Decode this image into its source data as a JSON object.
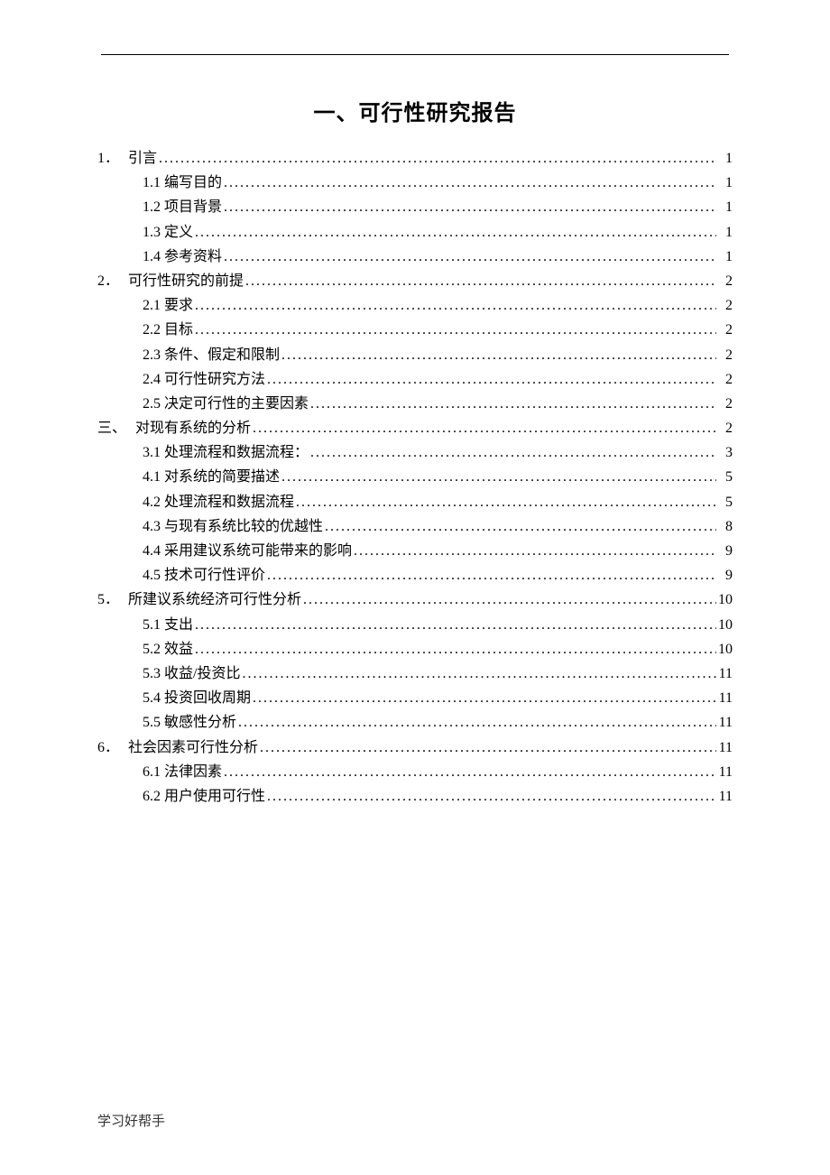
{
  "title": "一、可行性研究报告",
  "footer": "学习好帮手",
  "toc": [
    {
      "level": 1,
      "num": "1．",
      "label": "引言",
      "page": "1"
    },
    {
      "level": 2,
      "num": "1.1",
      "label": "编写目的",
      "page": "1"
    },
    {
      "level": 2,
      "num": "1.2",
      "label": "项目背景",
      "page": "1"
    },
    {
      "level": 2,
      "num": "1.3",
      "label": "定义",
      "page": "1"
    },
    {
      "level": 2,
      "num": "1.4",
      "label": "参考资料",
      "page": "1"
    },
    {
      "level": 1,
      "num": "2．",
      "label": "可行性研究的前提",
      "page": "2"
    },
    {
      "level": 2,
      "num": "2.1",
      "label": "要求",
      "page": "2"
    },
    {
      "level": 2,
      "num": "2.2",
      "label": "目标",
      "page": "2"
    },
    {
      "level": 2,
      "num": "2.3",
      "label": "条件、假定和限制",
      "page": "2"
    },
    {
      "level": 2,
      "num": "2.4",
      "label": "可行性研究方法",
      "page": "2"
    },
    {
      "level": 2,
      "num": "2.5",
      "label": "决定可行性的主要因素",
      "page": "2"
    },
    {
      "level": 1,
      "num": "三、",
      "label": "对现有系统的分析",
      "page": "2"
    },
    {
      "level": 2,
      "num": "3.1",
      "label": "处理流程和数据流程：",
      "page": "3"
    },
    {
      "level": 2,
      "num": "4.1",
      "label": "对系统的简要描述",
      "page": "5"
    },
    {
      "level": 2,
      "num": "4.2",
      "label": "处理流程和数据流程",
      "page": "5"
    },
    {
      "level": 2,
      "num": "4.3",
      "label": "与现有系统比较的优越性",
      "page": "8"
    },
    {
      "level": 2,
      "num": "4.4",
      "label": "采用建议系统可能带来的影响",
      "page": "9"
    },
    {
      "level": 2,
      "num": "4.5",
      "label": "技术可行性评价",
      "page": "9"
    },
    {
      "level": 1,
      "num": "5．",
      "label": "所建议系统经济可行性分析",
      "page": "10"
    },
    {
      "level": 2,
      "num": "5.1",
      "label": "支出",
      "page": "10"
    },
    {
      "level": 2,
      "num": "5.2",
      "label": "效益",
      "page": "10"
    },
    {
      "level": 2,
      "num": "5.3",
      "label": "收益/投资比",
      "page": "11"
    },
    {
      "level": 2,
      "num": "5.4",
      "label": "投资回收周期",
      "page": "11"
    },
    {
      "level": 2,
      "num": "5.5",
      "label": "敏感性分析",
      "page": "11"
    },
    {
      "level": 1,
      "num": "6．",
      "label": "社会因素可行性分析",
      "page": "11"
    },
    {
      "level": 2,
      "num": "6.1",
      "label": "法律因素",
      "page": "11"
    },
    {
      "level": 2,
      "num": "6.2",
      "label": "用户使用可行性",
      "page": "11"
    }
  ]
}
